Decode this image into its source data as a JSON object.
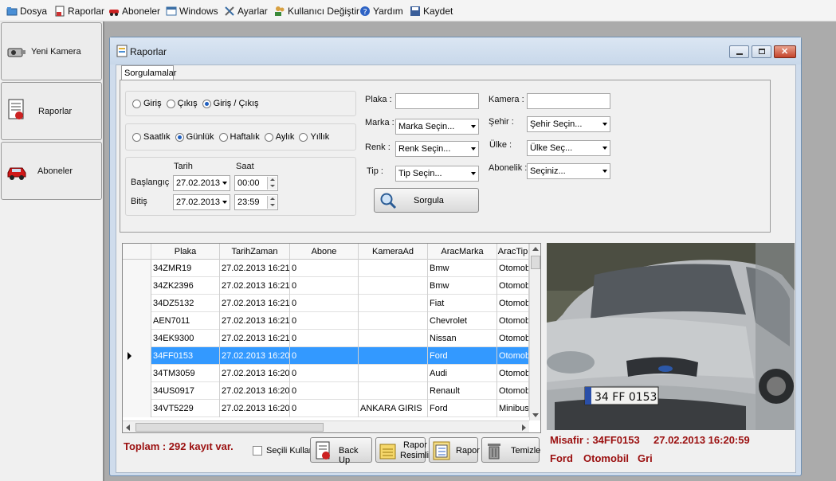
{
  "menu": {
    "items": [
      {
        "label": "Dosya",
        "icon": "folder-icon"
      },
      {
        "label": "Raporlar",
        "icon": "report-icon"
      },
      {
        "label": "Aboneler",
        "icon": "car-icon"
      },
      {
        "label": "Windows",
        "icon": "windows-icon"
      },
      {
        "label": "Ayarlar",
        "icon": "tools-icon"
      },
      {
        "label": "Kullanıcı Değiştir",
        "icon": "users-icon"
      },
      {
        "label": "Yardım",
        "icon": "help-icon"
      },
      {
        "label": "Kaydet",
        "icon": "save-icon"
      }
    ]
  },
  "sidebar": {
    "items": [
      {
        "label": "Yeni Kamera",
        "icon": "camera-icon"
      },
      {
        "label": "Raporlar",
        "icon": "report-icon"
      },
      {
        "label": "Aboneler",
        "icon": "car-icon"
      }
    ]
  },
  "window": {
    "title": "Raporlar"
  },
  "tab": {
    "label": "Sorgulamalar"
  },
  "filters": {
    "direction": {
      "options": [
        "Giriş",
        "Çıkış",
        "Giriş / Çıkış"
      ],
      "selected": "Giriş / Çıkış"
    },
    "period": {
      "options": [
        "Saatlık",
        "Günlük",
        "Haftalık",
        "Aylık",
        "Yıllık"
      ],
      "selected": "Günlük"
    },
    "tarih_label": "Tarih",
    "saat_label": "Saat",
    "baslangic_label": "Başlangıç",
    "bitis_label": "Bitiş",
    "start_date": "27.02.2013",
    "start_time": "00:00",
    "end_date": "27.02.2013",
    "end_time": "23:59",
    "plaka_label": "Plaka :",
    "plaka_value": "",
    "marka_label": "Marka :",
    "marka_value": "Marka Seçin...",
    "renk_label": "Renk :",
    "renk_value": "Renk Seçin...",
    "tip_label": "Tip :",
    "tip_value": "Tip Seçin...",
    "kamera_label": "Kamera :",
    "kamera_value": "",
    "sehir_label": "Şehir :",
    "sehir_value": "Şehir Seçin...",
    "ulke_label": "Ülke :",
    "ulke_value": "Ülke Seç...",
    "abonelik_label": "Abonelik :",
    "abonelik_value": "Seçiniz...",
    "sorgula_label": "Sorgula"
  },
  "grid": {
    "columns": [
      "Plaka",
      "TarihZaman",
      "Abone",
      "KameraAd",
      "AracMarka",
      "AracTip"
    ],
    "rows": [
      [
        "34ZMR19",
        "27.02.2013 16:21",
        "0",
        "",
        "Bmw",
        "Otomobil"
      ],
      [
        "34ZK2396",
        "27.02.2013 16:21",
        "0",
        "",
        "Bmw",
        "Otomobil"
      ],
      [
        "34DZ5132",
        "27.02.2013 16:21",
        "0",
        "",
        "Fiat",
        "Otomobil"
      ],
      [
        "AEN7011",
        "27.02.2013 16:21",
        "0",
        "",
        "Chevrolet",
        "Otomobil"
      ],
      [
        "34EK9300",
        "27.02.2013 16:21",
        "0",
        "",
        "Nissan",
        "Otomobil"
      ],
      [
        "34FF0153",
        "27.02.2013 16:20",
        "0",
        "",
        "Ford",
        "Otomobil"
      ],
      [
        "34TM3059",
        "27.02.2013 16:20",
        "0",
        "",
        "Audi",
        "Otomobil"
      ],
      [
        "34US0917",
        "27.02.2013 16:20",
        "0",
        "",
        "Renault",
        "Otomobil"
      ],
      [
        "34VT5229",
        "27.02.2013 16:20",
        "0",
        "ANKARA GIRIS",
        "Ford",
        "Minibus"
      ]
    ],
    "selected_index": 5
  },
  "footer": {
    "total": "Toplam : 292 kayıt var.",
    "secili_kullan": "Seçili Kullan",
    "backup": "Back Up",
    "rapor_resimli_1": "Rapor",
    "rapor_resimli_2": "Resimli",
    "rapor": "Rapor",
    "temizle": "Temizle"
  },
  "detail": {
    "line1_a": "Misafir : 34FF0153",
    "line1_b": "27.02.2013 16:20:59",
    "marka": "Ford",
    "tip": "Otomobil",
    "renk": "Gri",
    "plate": "34 FF 0153"
  },
  "colors": {
    "selected_row": "#3399ff",
    "accent_red": "#9b1010"
  }
}
